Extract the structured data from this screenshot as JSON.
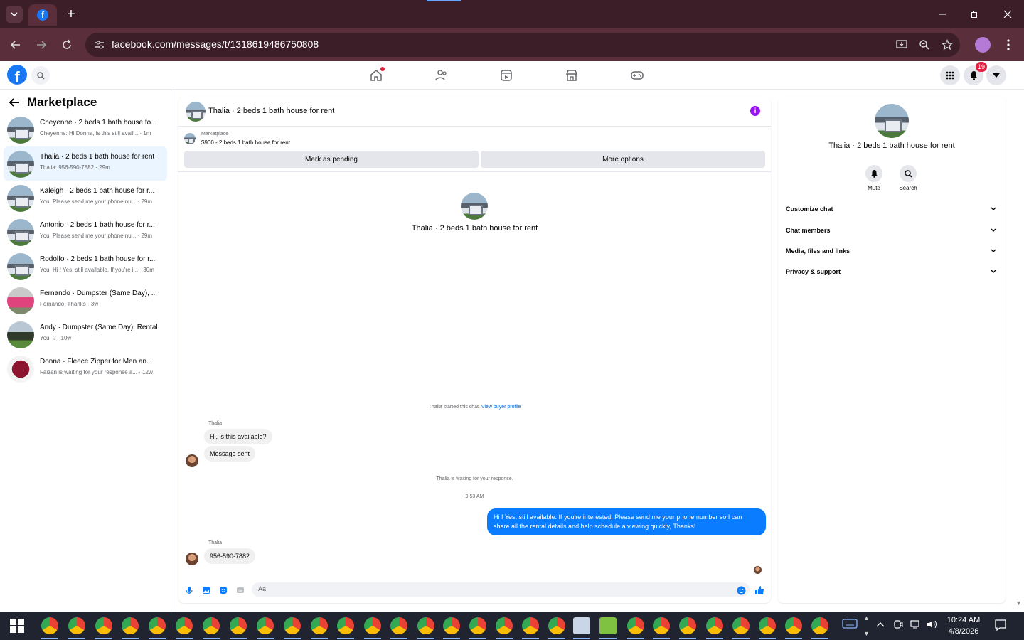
{
  "browser": {
    "url": "facebook.com/messages/t/1318619486750808",
    "new_tab_symbol": "+",
    "colors": {
      "tabbar": "#3c1e28",
      "toolbar": "#5a2e3a"
    }
  },
  "fb_header": {
    "notification_count": "19",
    "brand_color": "#1877f2"
  },
  "sidebar": {
    "title": "Marketplace",
    "conversations": [
      {
        "name": "Cheyenne · 2 beds 1 bath house fo...",
        "preview": "Cheyenne: Hi Donna, is this still avail... · 1m",
        "avatar": "house"
      },
      {
        "name": "Thalia · 2 beds 1 bath house for rent",
        "preview": "Thalia: 956-590-7882 · 29m",
        "avatar": "house",
        "active": true
      },
      {
        "name": "Kaleigh · 2 beds 1 bath house for r...",
        "preview": "You: Please send me your phone nu... · 29m",
        "avatar": "house"
      },
      {
        "name": "Antonio · 2 beds 1 bath house for r...",
        "preview": "You: Please send me your phone nu... · 29m",
        "avatar": "house"
      },
      {
        "name": "Rodolfo · 2 beds 1 bath house for r...",
        "preview": "You: Hi ! Yes, still available. If you're i... · 30m",
        "avatar": "house"
      },
      {
        "name": "Fernando · Dumpster (Same Day), ...",
        "preview": "Fernando: Thanks · 3w",
        "avatar": "dumpster-pink"
      },
      {
        "name": "Andy · Dumpster (Same Day), Rental",
        "preview": "You: ? · 10w",
        "avatar": "dumpster-dark"
      },
      {
        "name": "Donna · Fleece Zipper for Men an...",
        "preview": "Faizan is waiting for your response a... · 12w",
        "avatar": "fleece"
      }
    ]
  },
  "chat": {
    "title": "Thalia · 2 beds 1 bath house for rent",
    "listing_source": "Marketplace",
    "listing_price_title": "$900 - 2 beds 1 bath house for rent",
    "mark_pending_label": "Mark as pending",
    "more_options_label": "More options",
    "intro_name": "Thalia · 2 beds 1 bath house for rent",
    "started_text": "Thalia started this chat.",
    "view_profile_link": "View buyer profile",
    "sender_name_1": "Thalia",
    "msg_1": "Hi, is this available?",
    "msg_2": "Message sent",
    "waiting_text": "Thalia is waiting for your response.",
    "time_label": "9:53 AM",
    "outgoing_msg": "Hi ! Yes, still available. If you're interested, Please send me your phone number so I can share all the rental details and help schedule a viewing quickly, Thanks!",
    "sender_name_2": "Thalia",
    "msg_3": "956-590-7882",
    "composer_placeholder": "Aa",
    "outgoing_color": "#0a7cff",
    "info_color": "#9a13f2"
  },
  "right_panel": {
    "name": "Thalia · 2 beds 1 bath house for rent",
    "mute_label": "Mute",
    "search_label": "Search",
    "sections": [
      "Customize chat",
      "Chat members",
      "Media, files and links",
      "Privacy & support"
    ]
  },
  "taskbar": {
    "time": "10:24 AM",
    "date": "4/8/2026"
  }
}
